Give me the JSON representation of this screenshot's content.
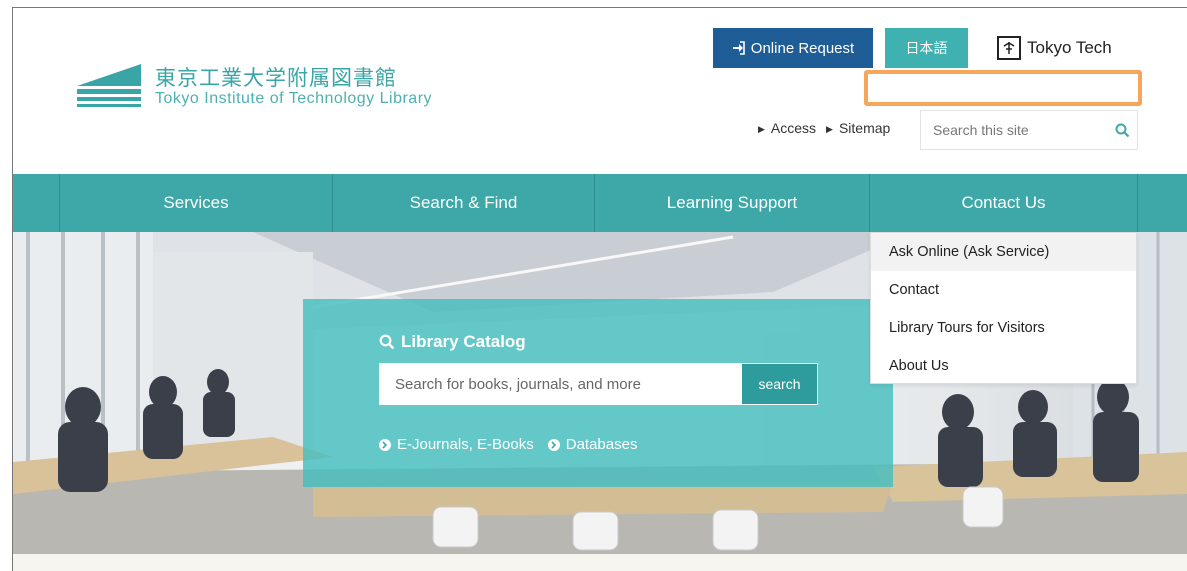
{
  "header": {
    "logo_jp": "東京工業大学附属図書館",
    "logo_en": "Tokyo Institute of Technology Library",
    "online_request": "Online Request",
    "language_button": "日本語",
    "tokyotech_label": "Tokyo Tech",
    "util_links": [
      "Access",
      "Sitemap"
    ],
    "search_placeholder": "Search this site"
  },
  "nav": {
    "items": [
      "Services",
      "Search & Find",
      "Learning Support",
      "Contact Us"
    ]
  },
  "dropdown": {
    "items": [
      "Ask Online (Ask Service)",
      "Contact",
      "Library Tours for Visitors",
      "About Us"
    ]
  },
  "catalog": {
    "title": "Library Catalog",
    "placeholder": "Search for books, journals, and more",
    "button": "search",
    "links": [
      "E-Journals, E-Books",
      "Databases"
    ]
  },
  "colors": {
    "teal": "#3ea8a9",
    "navy": "#1f5d96",
    "highlight": "#f5a65b"
  }
}
